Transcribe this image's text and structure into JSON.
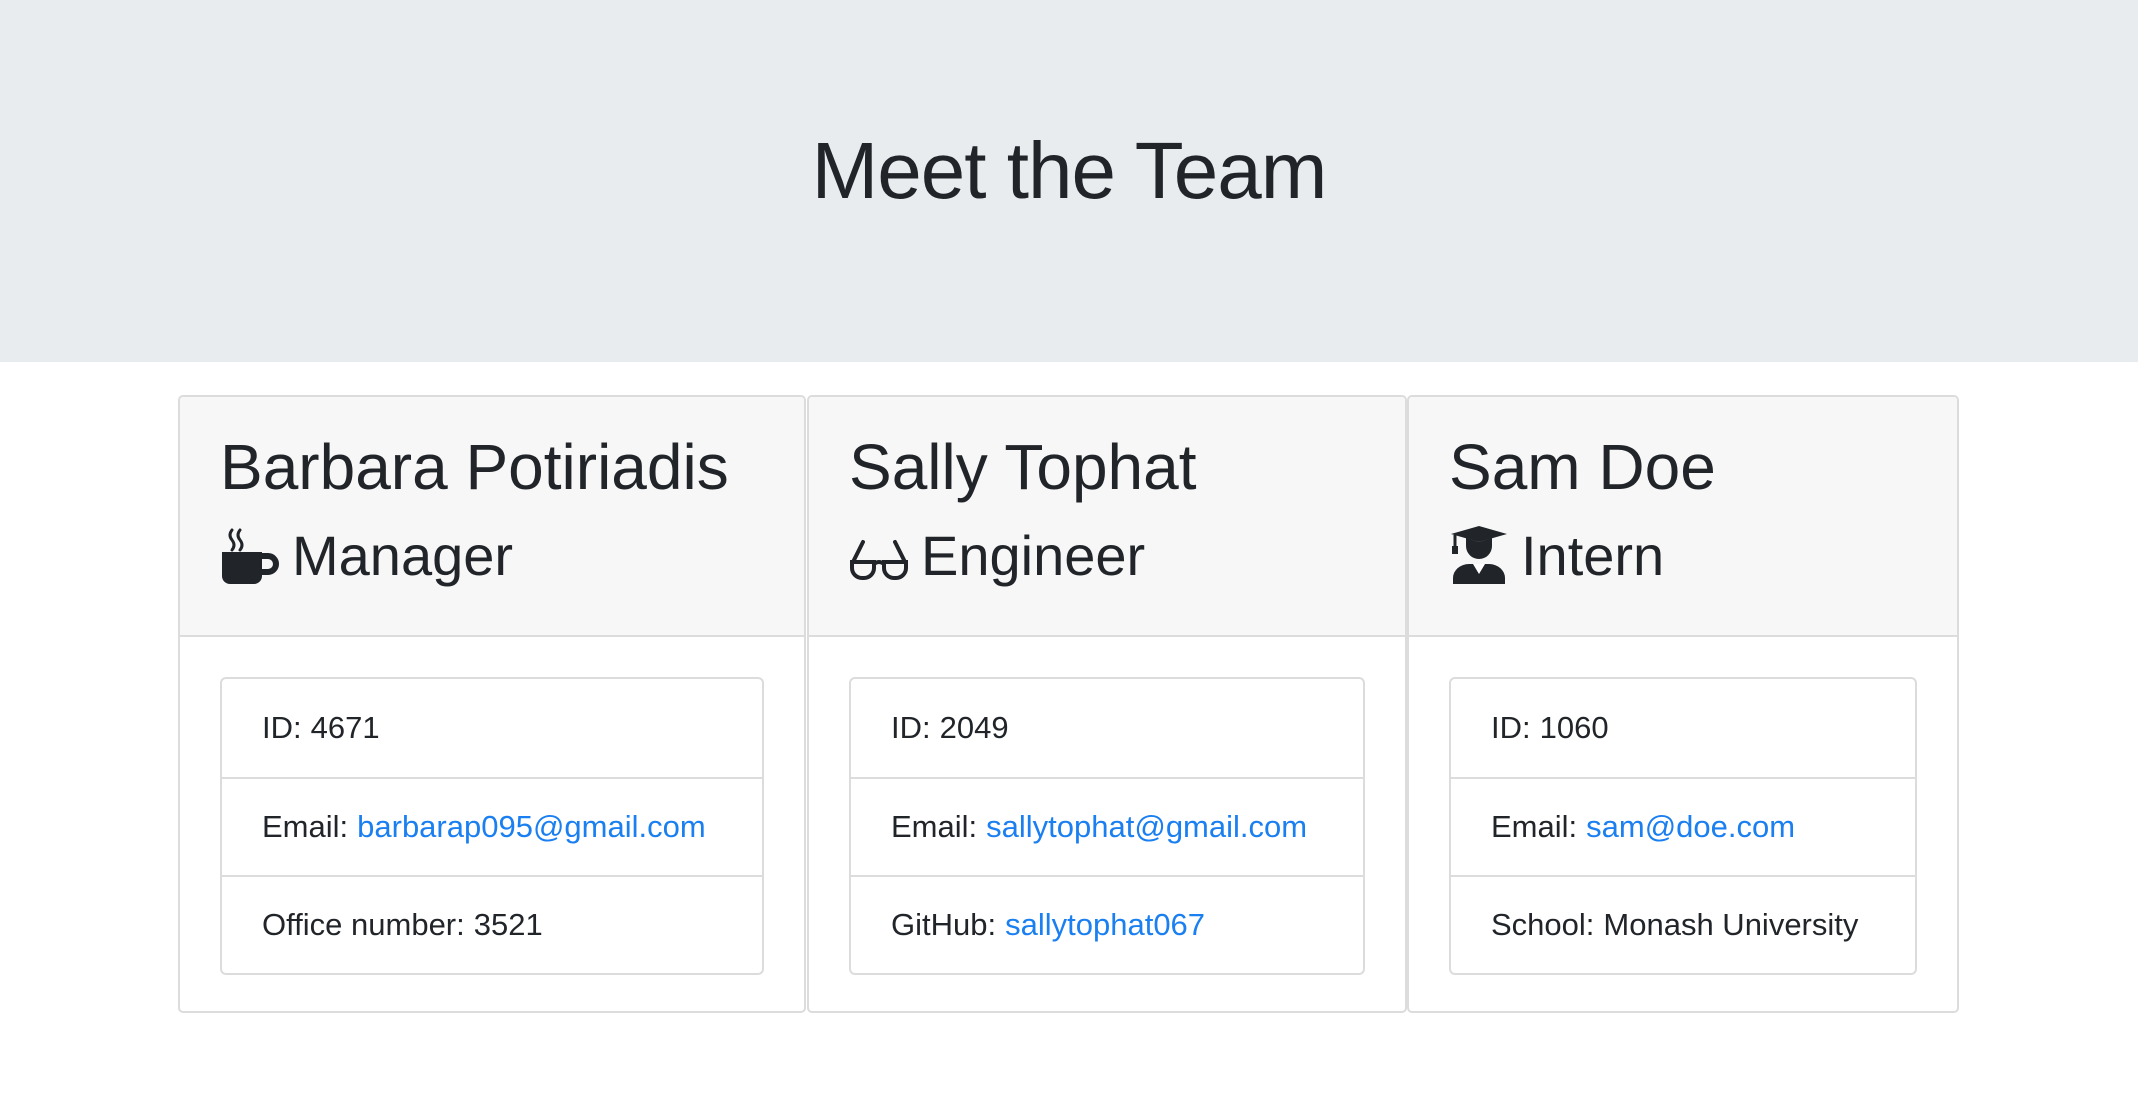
{
  "header": {
    "title": "Meet the Team"
  },
  "cards": [
    {
      "name": "Barbara Potiriadis",
      "role": "Manager",
      "role_icon": "coffee-mug-icon",
      "id_label": "ID:",
      "id_value": "4671",
      "email_label": "Email:",
      "email": "barbarap095@gmail.com",
      "extra_label": "Office number:",
      "extra_value": "3521"
    },
    {
      "name": "Sally Tophat",
      "role": "Engineer",
      "role_icon": "glasses-icon",
      "id_label": "ID:",
      "id_value": "2049",
      "email_label": "Email:",
      "email": "sallytophat@gmail.com",
      "extra_label": "GitHub:",
      "extra_value": "sallytophat067"
    },
    {
      "name": "Sam Doe",
      "role": "Intern",
      "role_icon": "graduate-icon",
      "id_label": "ID:",
      "id_value": "1060",
      "email_label": "Email:",
      "email": "sam@doe.com",
      "extra_label": "School:",
      "extra_value": "Monash University"
    }
  ],
  "colors": {
    "header_bg": "#e9ecef",
    "card_header_bg": "#f7f7f7",
    "link": "#1a7ff0",
    "text": "#212529"
  }
}
